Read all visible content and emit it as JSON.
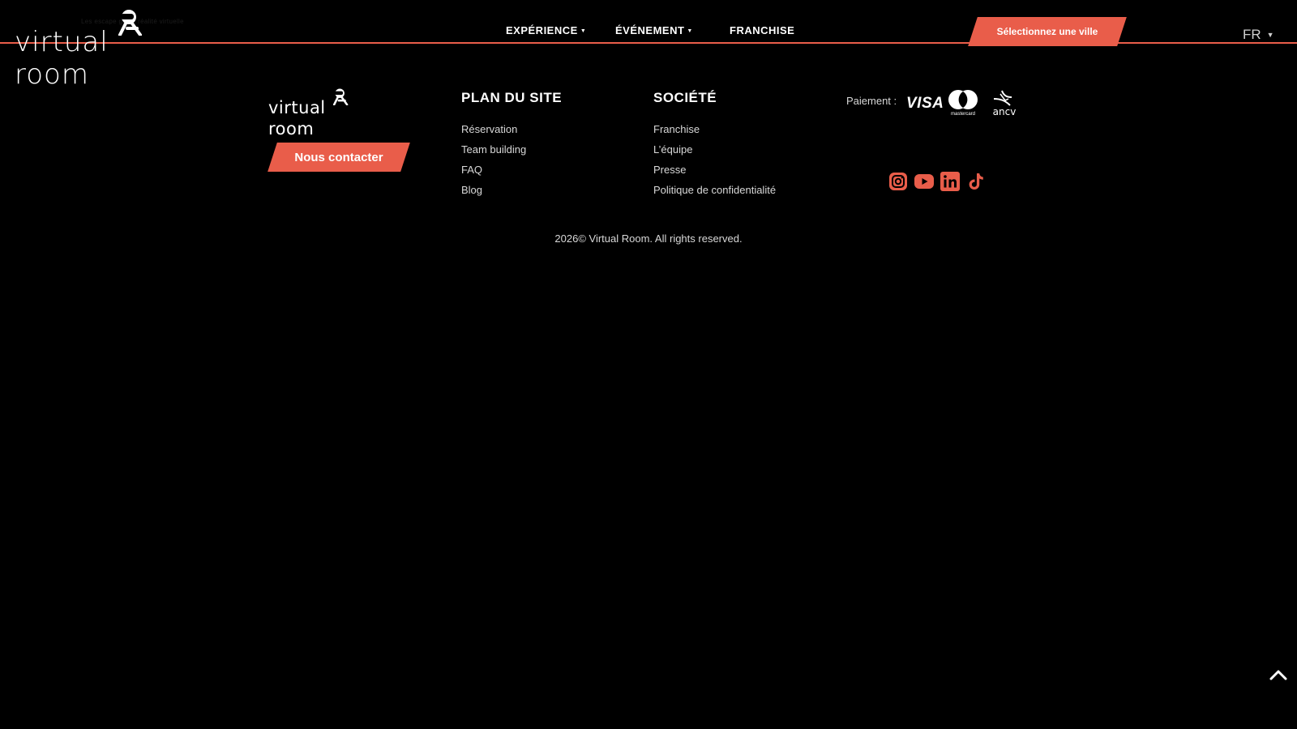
{
  "header": {
    "logo_tagline": "Les escape game réalité virtuelle",
    "logo_text": "virtual room",
    "nav": [
      {
        "label": "EXPÉRIENCE",
        "has_dropdown": true
      },
      {
        "label": "ÉVÉNEMENT",
        "has_dropdown": true
      },
      {
        "label": "FRANCHISE",
        "has_dropdown": false
      }
    ],
    "city_button": "Sélectionnez une ville",
    "language": "FR"
  },
  "footer": {
    "logo_text": "virtual room",
    "contact_button": "Nous contacter",
    "sitemap": {
      "title": "PLAN DU SITE",
      "links": [
        "Réservation",
        "Team building",
        "FAQ",
        "Blog"
      ]
    },
    "company": {
      "title": "SOCIÉTÉ",
      "links": [
        "Franchise",
        "L’équipe",
        "Presse",
        "Politique de confidentialité"
      ]
    },
    "payment": {
      "label": "Paiement :",
      "methods": [
        "VISA",
        "mastercard",
        "ancv"
      ]
    },
    "social": [
      "instagram-icon",
      "youtube-icon",
      "linkedin-icon",
      "tiktok-icon"
    ],
    "copyright": "2026© Virtual Room. All rights reserved."
  },
  "colors": {
    "accent": "#e95d4a",
    "background": "#000000",
    "text": "#ffffff"
  }
}
